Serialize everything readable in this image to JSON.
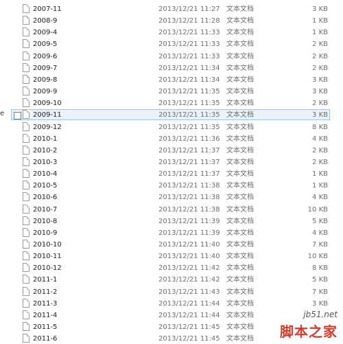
{
  "files": [
    {
      "name": "2007-11",
      "date": "2013/12/21 11:27",
      "type": "文本文档",
      "size": "3 KB"
    },
    {
      "name": "2008-9",
      "date": "2013/12/21 11:28",
      "type": "文本文档",
      "size": "1 KB"
    },
    {
      "name": "2009-4",
      "date": "2013/12/21 11:33",
      "type": "文本文档",
      "size": "1 KB"
    },
    {
      "name": "2009-5",
      "date": "2013/12/21 11:33",
      "type": "文本文档",
      "size": "2 KB"
    },
    {
      "name": "2009-6",
      "date": "2013/12/21 11:33",
      "type": "文本文档",
      "size": "2 KB"
    },
    {
      "name": "2009-7",
      "date": "2013/12/21 11:34",
      "type": "文本文档",
      "size": "2 KB"
    },
    {
      "name": "2009-8",
      "date": "2013/12/21 11:34",
      "type": "文本文档",
      "size": "3 KB"
    },
    {
      "name": "2009-9",
      "date": "2013/12/21 11:35",
      "type": "文本文档",
      "size": "3 KB"
    },
    {
      "name": "2009-10",
      "date": "2013/12/21 11:35",
      "type": "文本文档",
      "size": "2 KB"
    },
    {
      "name": "2009-11",
      "date": "2013/12/21 11:35",
      "type": "文本文档",
      "size": "3 KB"
    },
    {
      "name": "2009-12",
      "date": "2013/12/21 11:35",
      "type": "文本文档",
      "size": "8 KB"
    },
    {
      "name": "2010-1",
      "date": "2013/12/21 11:36",
      "type": "文本文档",
      "size": "4 KB"
    },
    {
      "name": "2010-2",
      "date": "2013/12/21 11:37",
      "type": "文本文档",
      "size": "2 KB"
    },
    {
      "name": "2010-3",
      "date": "2013/12/21 11:37",
      "type": "文本文档",
      "size": "2 KB"
    },
    {
      "name": "2010-4",
      "date": "2013/12/21 11:37",
      "type": "文本文档",
      "size": "1 KB"
    },
    {
      "name": "2010-5",
      "date": "2013/12/21 11:38",
      "type": "文本文档",
      "size": "1 KB"
    },
    {
      "name": "2010-6",
      "date": "2013/12/21 11:38",
      "type": "文本文档",
      "size": "4 KB"
    },
    {
      "name": "2010-7",
      "date": "2013/12/21 11:38",
      "type": "文本文档",
      "size": "10 KB"
    },
    {
      "name": "2010-8",
      "date": "2013/12/21 11:39",
      "type": "文本文档",
      "size": "5 KB"
    },
    {
      "name": "2010-9",
      "date": "2013/12/21 11:39",
      "type": "文本文档",
      "size": "4 KB"
    },
    {
      "name": "2010-10",
      "date": "2013/12/21 11:40",
      "type": "文本文档",
      "size": "7 KB"
    },
    {
      "name": "2010-11",
      "date": "2013/12/21 11:40",
      "type": "文本文档",
      "size": "10 KB"
    },
    {
      "name": "2010-12",
      "date": "2013/12/21 11:42",
      "type": "文本文档",
      "size": "8 KB"
    },
    {
      "name": "2011-1",
      "date": "2013/12/21 11:42",
      "type": "文本文档",
      "size": "5 KB"
    },
    {
      "name": "2011-2",
      "date": "2013/12/21 11:43",
      "type": "文本文档",
      "size": "7 KB"
    },
    {
      "name": "2011-3",
      "date": "2013/12/21 11:44",
      "type": "文本文档",
      "size": "3 KB"
    },
    {
      "name": "2011-4",
      "date": "2013/12/21 11:44",
      "type": "文本文档",
      "size": ""
    },
    {
      "name": "2011-5",
      "date": "2013/12/21 11:45",
      "type": "文本文档",
      "size": ""
    },
    {
      "name": "2011-6",
      "date": "2013/12/21 11:45",
      "type": "文本文档",
      "size": ""
    }
  ],
  "selected_file": "2009-11",
  "left_pane_fragment": "e",
  "icons": {
    "file": "text-document-icon",
    "checkbox": "selection-checkbox"
  },
  "watermark": {
    "url": "jb51.net",
    "logo_text": "脚本之家"
  },
  "colors": {
    "selection_fill": "#eaf3fb",
    "selection_border": "#99c5ea",
    "watermark_red": "#d43a2a"
  }
}
